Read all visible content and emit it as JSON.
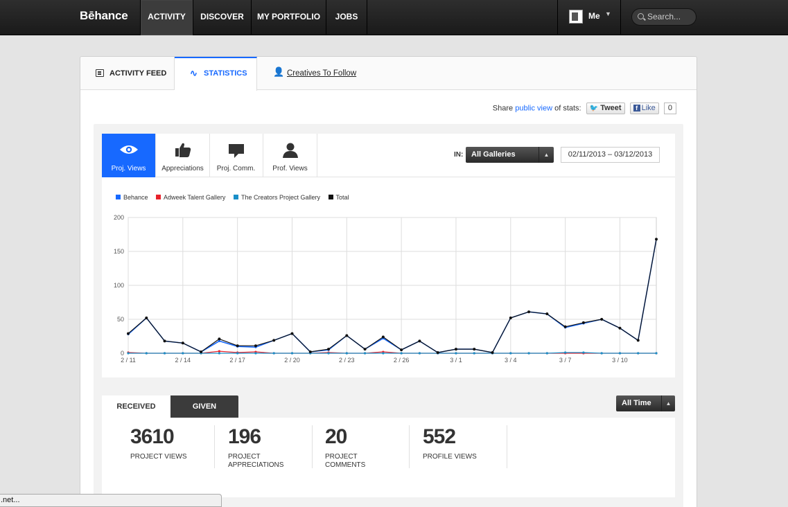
{
  "nav": {
    "logo": "Bēhance",
    "items": [
      {
        "label": "ACTIVITY"
      },
      {
        "label": "DISCOVER"
      },
      {
        "label": "MY PORTFOLIO"
      },
      {
        "label": "JOBS"
      }
    ],
    "me_label": "Me",
    "search_placeholder": "Search..."
  },
  "tabs": {
    "feed": "ACTIVITY FEED",
    "statistics": "STATISTICS",
    "creatives": "Creatives To Follow"
  },
  "share": {
    "prefix": "Share",
    "link": "public view",
    "suffix": "of stats:",
    "tweet": "Tweet",
    "like": "Like",
    "like_count": "0"
  },
  "metric_tabs": [
    {
      "label": "Proj. Views",
      "icon": "eye-icon"
    },
    {
      "label": "Appreciations",
      "icon": "thumbs-up-icon"
    },
    {
      "label": "Proj. Comm.",
      "icon": "comment-icon"
    },
    {
      "label": "Prof. Views",
      "icon": "person-icon"
    }
  ],
  "filters": {
    "in_label": "IN:",
    "gallery": "All Galleries",
    "date_range": "02/11/2013 – 03/12/2013"
  },
  "colors": {
    "accent": "#1769ff",
    "behance": "#1769ff",
    "adweek": "#e8222b",
    "creators": "#1a8fc8",
    "total": "#111111"
  },
  "chart_data": {
    "type": "line",
    "xlabel": "",
    "ylabel": "",
    "ylim": [
      0,
      200
    ],
    "yticks": [
      0,
      50,
      100,
      150,
      200
    ],
    "grid": true,
    "legend_position": "top-left",
    "xtick_labels": [
      "2 / 11",
      "2 / 14",
      "2 / 17",
      "2 / 20",
      "2 / 23",
      "2 / 26",
      "3 / 1",
      "3 / 4",
      "3 / 7",
      "3 / 10"
    ],
    "x": [
      "2/11",
      "2/12",
      "2/13",
      "2/14",
      "2/15",
      "2/16",
      "2/17",
      "2/18",
      "2/19",
      "2/20",
      "2/21",
      "2/22",
      "2/23",
      "2/24",
      "2/25",
      "2/26",
      "2/27",
      "2/28",
      "3/1",
      "3/2",
      "3/3",
      "3/4",
      "3/5",
      "3/6",
      "3/7",
      "3/8",
      "3/9",
      "3/10",
      "3/11",
      "3/12"
    ],
    "series": [
      {
        "name": "Behance",
        "color": "#1769ff",
        "values": [
          28,
          52,
          18,
          15,
          2,
          18,
          10,
          9,
          19,
          29,
          2,
          5,
          26,
          6,
          22,
          5,
          18,
          1,
          6,
          6,
          1,
          52,
          61,
          58,
          38,
          44,
          50,
          37,
          19,
          168
        ]
      },
      {
        "name": "Adweek Talent Gallery",
        "color": "#e8222b",
        "values": [
          1,
          0,
          0,
          0,
          0,
          3,
          1,
          2,
          0,
          0,
          0,
          1,
          0,
          0,
          2,
          0,
          0,
          0,
          0,
          0,
          0,
          0,
          0,
          0,
          0,
          0,
          0,
          0,
          0,
          0
        ]
      },
      {
        "name": "The Creators Project Gallery",
        "color": "#1a8fc8",
        "values": [
          0,
          0,
          0,
          0,
          0,
          0,
          0,
          0,
          0,
          0,
          0,
          0,
          0,
          0,
          0,
          0,
          0,
          0,
          0,
          0,
          0,
          0,
          0,
          0,
          1,
          1,
          0,
          0,
          0,
          0
        ]
      },
      {
        "name": "Total",
        "color": "#111111",
        "values": [
          29,
          52,
          18,
          15,
          2,
          21,
          11,
          11,
          19,
          29,
          2,
          6,
          26,
          6,
          24,
          5,
          18,
          1,
          6,
          6,
          1,
          52,
          61,
          58,
          39,
          45,
          50,
          37,
          19,
          168
        ]
      }
    ]
  },
  "received_tabs": {
    "received": "RECEIVED",
    "given": "GIVEN",
    "period": "All Time"
  },
  "summary": [
    {
      "value": "3610",
      "label": "PROJECT VIEWS"
    },
    {
      "value": "196",
      "label": "PROJECT APPRECIATIONS"
    },
    {
      "value": "20",
      "label": "PROJECT COMMENTS"
    },
    {
      "value": "552",
      "label": "PROFILE VIEWS"
    }
  ],
  "status_bar": ".net..."
}
